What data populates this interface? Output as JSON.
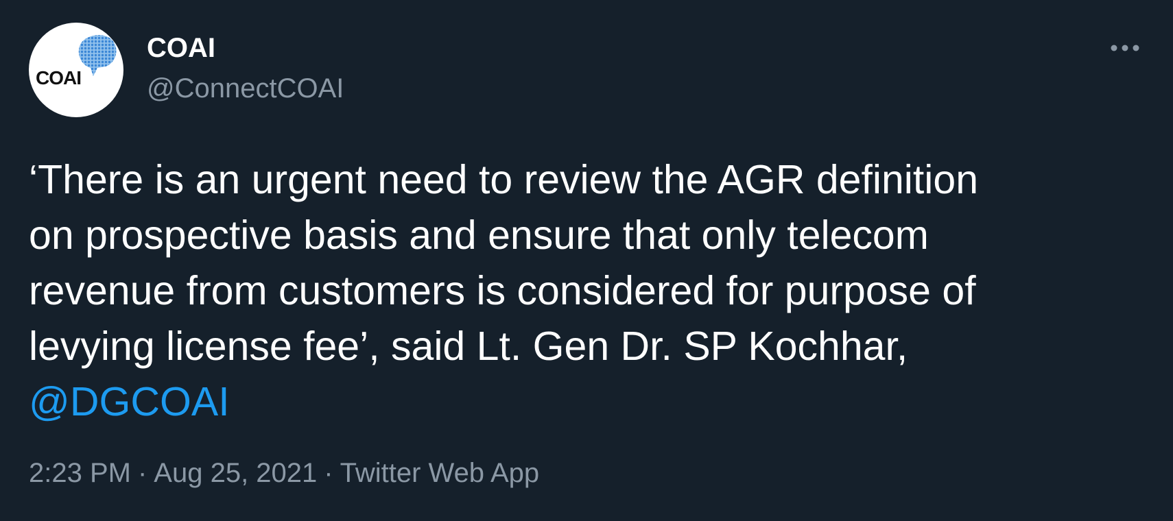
{
  "author": {
    "display_name": "COAI",
    "handle": "@ConnectCOAI",
    "avatar_text": "COAI",
    "avatar_icon": "coai-logo-icon"
  },
  "menu": {
    "icon": "more-horizontal-icon"
  },
  "tweet": {
    "text": "‘There is an urgent need to review the AGR definition\non prospective basis and ensure that only telecom\nrevenue from customers is considered for purpose of\nlevying license fee’, said Lt. Gen Dr. SP Kochhar,",
    "mention": "@DGCOAI"
  },
  "meta": {
    "time": "2:23 PM",
    "separator": "·",
    "date": "Aug 25, 2021",
    "source": "Twitter Web App"
  },
  "colors": {
    "background": "#15202b",
    "primary_text": "#ffffff",
    "secondary_text": "#8b98a5",
    "link": "#1d9bf0"
  }
}
